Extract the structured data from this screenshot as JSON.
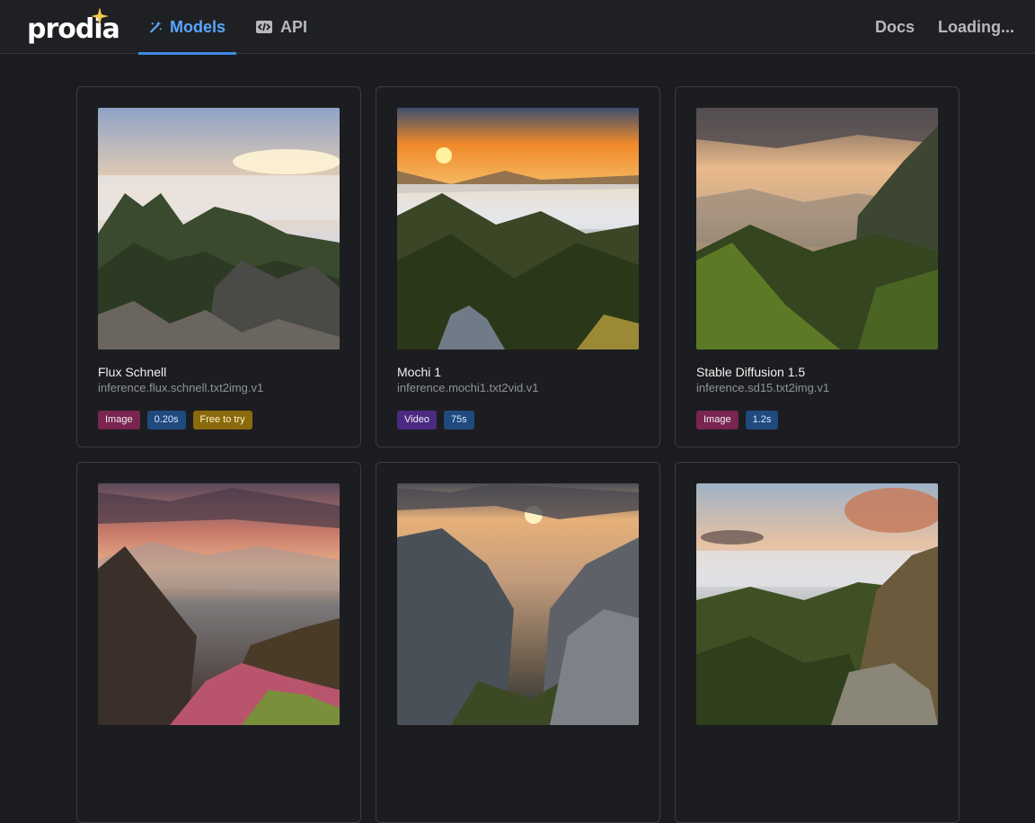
{
  "header": {
    "logo_text": "prodia",
    "tabs": [
      {
        "label": "Models",
        "icon": "magic-wand-icon",
        "active": true
      },
      {
        "label": "API",
        "icon": "code-icon",
        "active": false
      }
    ],
    "right_links": [
      {
        "label": "Docs"
      },
      {
        "label": "Loading..."
      }
    ]
  },
  "models": [
    {
      "title": "Flux Schnell",
      "id": "inference.flux.schnell.txt2img.v1",
      "badges": {
        "type": "Image",
        "time": "0.20s",
        "extra": "Free to try"
      }
    },
    {
      "title": "Mochi 1",
      "id": "inference.mochi1.txt2vid.v1",
      "badges": {
        "type": "Video",
        "time": "75s"
      }
    },
    {
      "title": "Stable Diffusion 1.5",
      "id": "inference.sd15.txt2img.v1",
      "badges": {
        "type": "Image",
        "time": "1.2s"
      }
    },
    {
      "title": "",
      "id": ""
    },
    {
      "title": "",
      "id": ""
    },
    {
      "title": "",
      "id": ""
    }
  ],
  "colors": {
    "accent": "#58a6ff",
    "image_badge": "#7a2450",
    "video_badge": "#4b2a82",
    "time_badge": "#1f4a7e",
    "free_badge": "#8a6a0c"
  }
}
